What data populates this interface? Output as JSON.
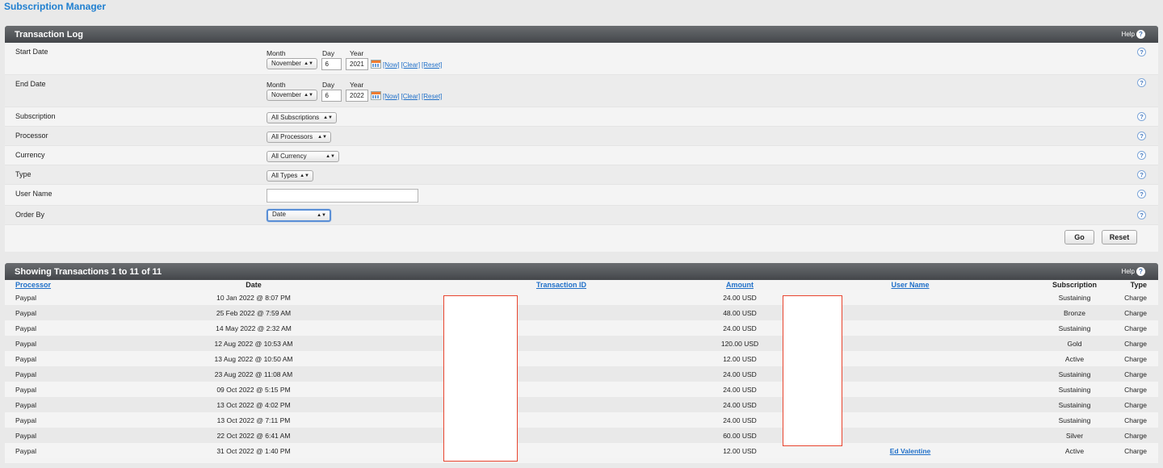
{
  "app_title": "Subscription Manager",
  "transaction_log": {
    "title": "Transaction Log",
    "help_label": "Help",
    "start_date": {
      "label": "Start Date",
      "month_label": "Month",
      "day_label": "Day",
      "year_label": "Year",
      "month": "November",
      "day": "6",
      "year": "2021",
      "now_link": "[Now]",
      "clear_link": "[Clear]",
      "reset_link": "[Reset]"
    },
    "end_date": {
      "label": "End Date",
      "month_label": "Month",
      "day_label": "Day",
      "year_label": "Year",
      "month": "November",
      "day": "6",
      "year": "2022",
      "now_link": "[Now]",
      "clear_link": "[Clear]",
      "reset_link": "[Reset]"
    },
    "subscription": {
      "label": "Subscription",
      "value": "All Subscriptions"
    },
    "processor": {
      "label": "Processor",
      "value": "All Processors"
    },
    "currency": {
      "label": "Currency",
      "value": "All Currency"
    },
    "type": {
      "label": "Type",
      "value": "All Types"
    },
    "user_name": {
      "label": "User Name",
      "value": ""
    },
    "order_by": {
      "label": "Order By",
      "value": "Date"
    },
    "go_button": "Go",
    "reset_button": "Reset",
    "help_icon_glyph": "?"
  },
  "results": {
    "title": "Showing Transactions 1 to 11 of 11",
    "help_label": "Help",
    "columns": [
      "Processor",
      "Date",
      "Transaction ID",
      "Amount",
      "User Name",
      "Subscription",
      "Type"
    ],
    "rows": [
      {
        "processor": "Paypal",
        "date": "10 Jan 2022 @ 8:07 PM",
        "transaction_id": "",
        "amount": "24.00 USD",
        "user_name": "",
        "subscription": "Sustaining",
        "type": "Charge"
      },
      {
        "processor": "Paypal",
        "date": "25 Feb 2022 @ 7:59 AM",
        "transaction_id": "",
        "amount": "48.00 USD",
        "user_name": "",
        "subscription": "Bronze",
        "type": "Charge"
      },
      {
        "processor": "Paypal",
        "date": "14 May 2022 @ 2:32 AM",
        "transaction_id": "",
        "amount": "24.00 USD",
        "user_name": "",
        "subscription": "Sustaining",
        "type": "Charge"
      },
      {
        "processor": "Paypal",
        "date": "12 Aug 2022 @ 10:53 AM",
        "transaction_id": "",
        "amount": "120.00 USD",
        "user_name": "",
        "subscription": "Gold",
        "type": "Charge"
      },
      {
        "processor": "Paypal",
        "date": "13 Aug 2022 @ 10:50 AM",
        "transaction_id": "",
        "amount": "12.00 USD",
        "user_name": "",
        "subscription": "Active",
        "type": "Charge"
      },
      {
        "processor": "Paypal",
        "date": "23 Aug 2022 @ 11:08 AM",
        "transaction_id": "",
        "amount": "24.00 USD",
        "user_name": "",
        "subscription": "Sustaining",
        "type": "Charge"
      },
      {
        "processor": "Paypal",
        "date": "09 Oct 2022 @ 5:15 PM",
        "transaction_id": "",
        "amount": "24.00 USD",
        "user_name": "",
        "subscription": "Sustaining",
        "type": "Charge"
      },
      {
        "processor": "Paypal",
        "date": "13 Oct 2022 @ 4:02 PM",
        "transaction_id": "",
        "amount": "24.00 USD",
        "user_name": "",
        "subscription": "Sustaining",
        "type": "Charge"
      },
      {
        "processor": "Paypal",
        "date": "13 Oct 2022 @ 7:11 PM",
        "transaction_id": "",
        "amount": "24.00 USD",
        "user_name": "",
        "subscription": "Sustaining",
        "type": "Charge"
      },
      {
        "processor": "Paypal",
        "date": "22 Oct 2022 @ 6:41 AM",
        "transaction_id": "",
        "amount": "60.00 USD",
        "user_name": "",
        "subscription": "Silver",
        "type": "Charge"
      },
      {
        "processor": "Paypal",
        "date": "31 Oct 2022 @ 1:40 PM",
        "transaction_id": "",
        "amount": "12.00 USD",
        "user_name": "Ed Valentine",
        "subscription": "Active",
        "type": "Charge"
      }
    ]
  },
  "colors": {
    "link": "#1f6fc8",
    "title_blue": "#1f7fd0",
    "header_dark": "#43464a",
    "redaction_border": "#e8442e"
  }
}
